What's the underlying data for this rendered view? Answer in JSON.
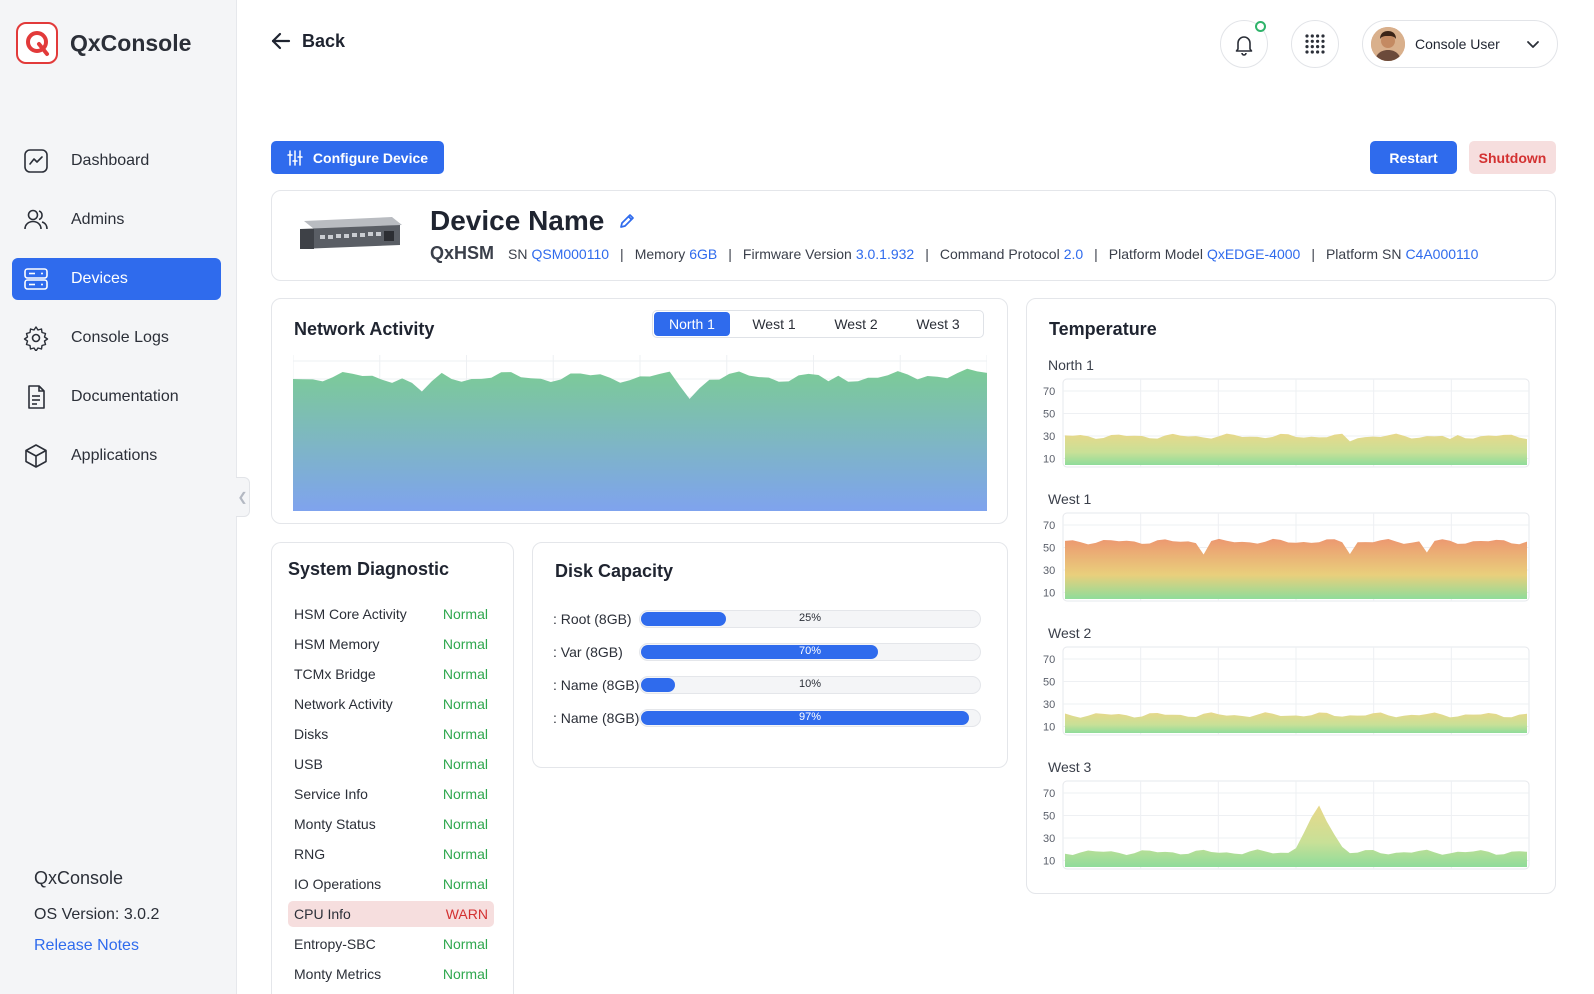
{
  "app": {
    "name": "QxConsole",
    "os_version": "OS Version: 3.0.2",
    "release_notes": "Release Notes"
  },
  "sidebar": {
    "items": [
      {
        "label": "Dashboard",
        "icon": "chart-line-icon",
        "active": false
      },
      {
        "label": "Admins",
        "icon": "users-icon",
        "active": false
      },
      {
        "label": "Devices",
        "icon": "server-icon",
        "active": true
      },
      {
        "label": "Console Logs",
        "icon": "gear-icon",
        "active": false
      },
      {
        "label": "Documentation",
        "icon": "document-icon",
        "active": false
      },
      {
        "label": "Applications",
        "icon": "cube-icon",
        "active": false
      }
    ]
  },
  "header": {
    "back_label": "Back",
    "user_name": "Console User"
  },
  "actions": {
    "configure_label": "Configure Device",
    "restart_label": "Restart",
    "shutdown_label": "Shutdown"
  },
  "device": {
    "name": "Device Name",
    "model": "QxHSM",
    "meta": [
      {
        "key": "SN",
        "value": "QSM000110"
      },
      {
        "key": "Memory",
        "value": "6GB"
      },
      {
        "key": "Firmware Version",
        "value": "3.0.1.932"
      },
      {
        "key": "Command Protocol",
        "value": "2.0"
      },
      {
        "key": "Platform Model",
        "value": "QxEDGE-4000"
      },
      {
        "key": "Platform SN",
        "value": "C4A000110"
      }
    ]
  },
  "network": {
    "title": "Network Activity",
    "tabs": [
      "North 1",
      "West 1",
      "West 2",
      "West 3"
    ],
    "active_tab": 0,
    "colors": {
      "top": "#7ccb96",
      "bottom": "#7fa3ee"
    }
  },
  "diagnostic": {
    "title": "System Diagnostic",
    "rows": [
      {
        "name": "HSM Core Activity",
        "status": "Normal"
      },
      {
        "name": "HSM Memory",
        "status": "Normal"
      },
      {
        "name": "TCMx Bridge",
        "status": "Normal"
      },
      {
        "name": "Network Activity",
        "status": "Normal"
      },
      {
        "name": "Disks",
        "status": "Normal"
      },
      {
        "name": "USB",
        "status": "Normal"
      },
      {
        "name": "Service Info",
        "status": "Normal"
      },
      {
        "name": "Monty Status",
        "status": "Normal"
      },
      {
        "name": "RNG",
        "status": "Normal"
      },
      {
        "name": "IO Operations",
        "status": "Normal"
      },
      {
        "name": "CPU Info",
        "status": "WARN"
      },
      {
        "name": "Entropy-SBC",
        "status": "Normal"
      },
      {
        "name": "Monty Metrics",
        "status": "Normal"
      }
    ]
  },
  "disk": {
    "title": "Disk Capacity",
    "rows": [
      {
        "label": ": Root (8GB)",
        "percent": 25,
        "percent_label": "25%"
      },
      {
        "label": ": Var (8GB)",
        "percent": 70,
        "percent_label": "70%"
      },
      {
        "label": ": Name (8GB)",
        "percent": 10,
        "percent_label": "10%"
      },
      {
        "label": ": Name (8GB)",
        "percent": 97,
        "percent_label": "97%"
      }
    ]
  },
  "temperature": {
    "title": "Temperature",
    "y_ticks": [
      "70",
      "50",
      "30",
      "10"
    ],
    "sensors": [
      {
        "name": "North 1",
        "level": 0.35
      },
      {
        "name": "West 1",
        "level": 0.7
      },
      {
        "name": "West 2",
        "level": 0.22
      },
      {
        "name": "West 3",
        "level": 0.18
      }
    ]
  }
}
